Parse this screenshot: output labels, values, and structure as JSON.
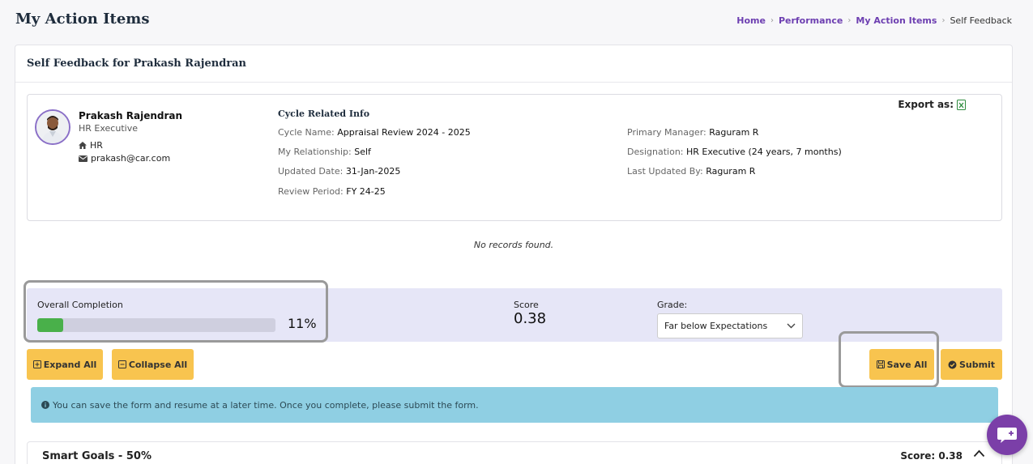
{
  "page": {
    "title": "My Action Items",
    "breadcrumb": {
      "home": "Home",
      "performance": "Performance",
      "action_items": "My Action Items",
      "current": "Self Feedback"
    }
  },
  "card": {
    "header": "Self Feedback for Prakash Rajendran"
  },
  "employee": {
    "name": "Prakash Rajendran",
    "role": "HR Executive",
    "department": "HR",
    "email": "prakash@car.com"
  },
  "cycle": {
    "heading": "Cycle Related Info",
    "cycle_name_label": "Cycle Name:",
    "cycle_name": "Appraisal Review 2024 - 2025",
    "relationship_label": "My Relationship:",
    "relationship": "Self",
    "updated_date_label": "Updated Date:",
    "updated_date": "31-Jan-2025",
    "review_period_label": "Review Period:",
    "review_period": "FY 24-25",
    "primary_manager_label": "Primary Manager:",
    "primary_manager": "Raguram R",
    "designation_label": "Designation:",
    "designation": "HR Executive (24 years, 7 months)",
    "last_updated_by_label": "Last Updated By:",
    "last_updated_by": "Raguram R"
  },
  "export": {
    "label": "Export as:",
    "icon": "excel-icon"
  },
  "no_records": "No records found.",
  "summary": {
    "completion_label": "Overall Completion",
    "completion_percent": 11,
    "completion_text": "11%",
    "score_label": "Score",
    "score_value": "0.38",
    "grade_label": "Grade:",
    "grade_value": "Far below Expectations"
  },
  "buttons": {
    "expand_all": "Expand All",
    "collapse_all": "Collapse All",
    "save_all": "Save All",
    "submit": "Submit"
  },
  "alert": {
    "text": "You can save the form and resume at a later time. Once you complete, please submit the form."
  },
  "section": {
    "title": "Smart Goals - 50%",
    "score": "Score: 0.38"
  },
  "colors": {
    "accent": "#6d3fb1",
    "button": "#f8c44f",
    "progress": "#49b04a",
    "summary_bg": "#e6e6f7",
    "alert_bg": "#8fcfe3",
    "chat_fab": "#7b3fa8"
  }
}
